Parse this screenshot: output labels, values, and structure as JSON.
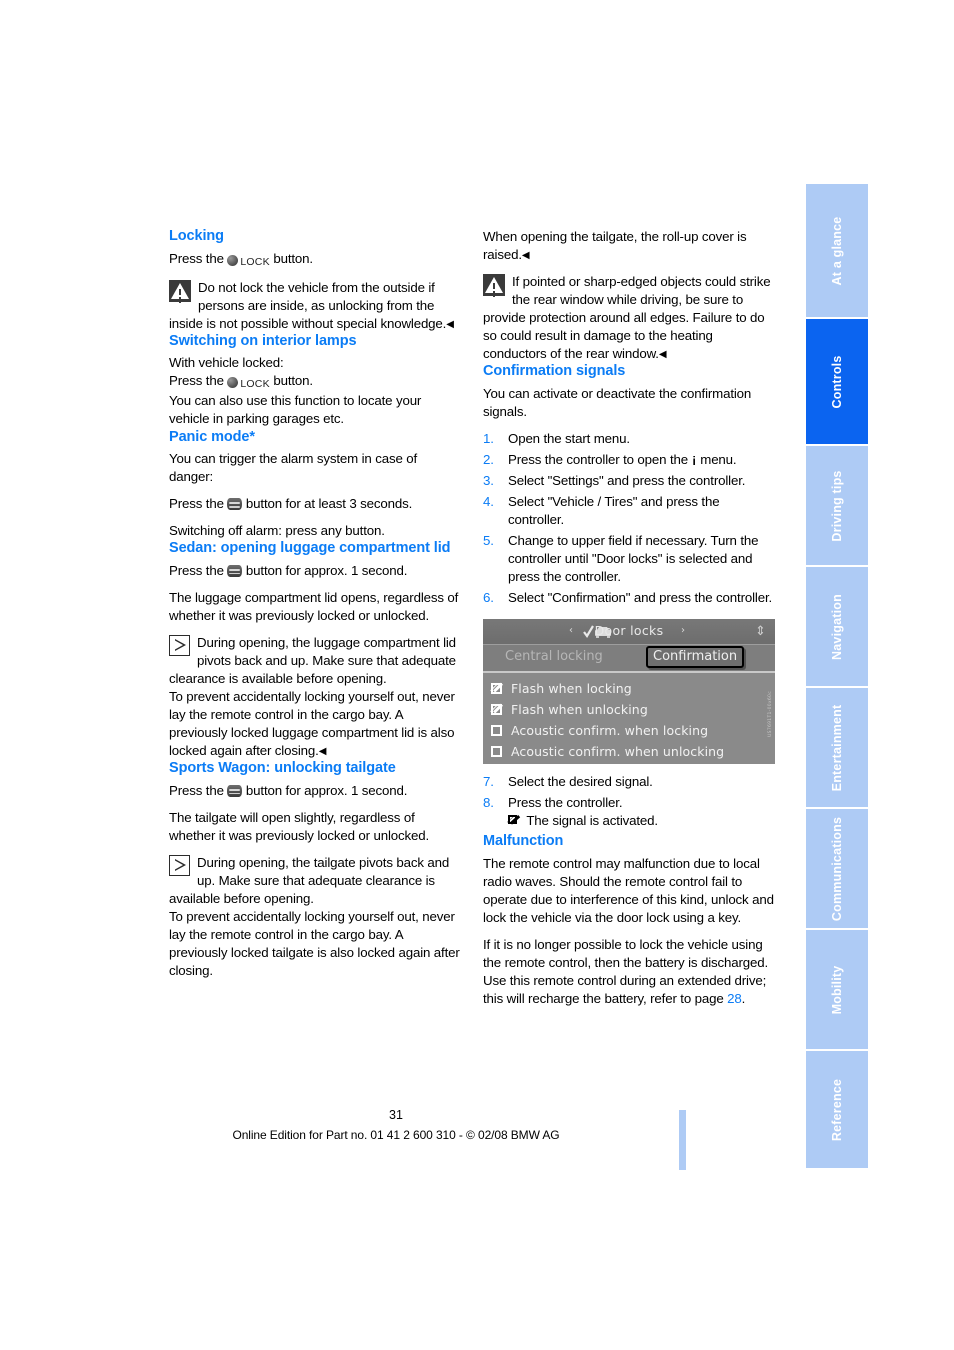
{
  "document": {
    "page_number": "31",
    "footer": "Online Edition for Part no. 01 41 2 600 310 - © 02/08 BMW AG",
    "accent_blue": "#0b7cf5",
    "tab_active_blue": "#0b64f0",
    "tab_inactive_blue": "#aecbf5"
  },
  "tabs": [
    {
      "label": "At a glance",
      "active": false
    },
    {
      "label": "Controls",
      "active": true
    },
    {
      "label": "Driving tips",
      "active": false
    },
    {
      "label": "Navigation",
      "active": false
    },
    {
      "label": "Entertainment",
      "active": false
    },
    {
      "label": "Communications",
      "active": false
    },
    {
      "label": "Mobility",
      "active": false
    },
    {
      "label": "Reference",
      "active": false
    }
  ],
  "left_column": {
    "locking": {
      "heading": "Locking",
      "press_prefix": "Press the ",
      "lock_label": "LOCK",
      "press_suffix": " button.",
      "warning": "Do not lock the vehicle from the outside if persons are inside, as unlocking from the inside is not possible without special knowledge."
    },
    "interior_lamps": {
      "heading": "Switching on interior lamps",
      "line1": "With vehicle locked:",
      "press_prefix": "Press the ",
      "lock_label": "LOCK",
      "press_suffix": " button.",
      "line2": "You can also use this function to locate your vehicle in parking garages etc."
    },
    "panic_mode": {
      "heading": "Panic mode*",
      "line1": "You can trigger the alarm system in case of danger:",
      "press_prefix": "Press the ",
      "press_suffix": " button for at least 3 seconds.",
      "line2": "Switching off alarm: press any button."
    },
    "sedan_luggage": {
      "heading": "Sedan: opening luggage compartment lid",
      "press_prefix": "Press the ",
      "press_suffix": " button for approx. 1 second.",
      "line1": "The luggage compartment lid opens, regardless of whether it was previously locked or unlocked.",
      "note": "During opening, the luggage compartment lid pivots back and up. Make sure that adequate clearance is available before opening.",
      "note2": "To prevent accidentally locking yourself out, never lay the remote control in the cargo bay. A previously locked luggage compartment lid is also locked again after closing."
    },
    "sports_wagon": {
      "heading": "Sports Wagon: unlocking tailgate",
      "press_prefix": "Press the ",
      "press_suffix": " button for approx. 1 second.",
      "line1": "The tailgate will open slightly, regardless of whether it was previously locked or unlocked.",
      "note": "During opening, the tailgate pivots back and up. Make sure that adequate clearance is available before opening.",
      "note2": "To prevent accidentally locking yourself out, never lay the remote control in the cargo bay. A previously locked tailgate is also locked again after closing."
    }
  },
  "right_column": {
    "rollup_cover": {
      "line1": "When opening the tailgate, the roll-up cover is raised.",
      "warning": "If pointed or sharp-edged objects could strike the rear window while driving, be sure to provide protection around all edges. Failure to do so could result in damage to the heating conductors of the rear window."
    },
    "confirmation_signals": {
      "heading": "Confirmation signals",
      "intro": "You can activate or deactivate the confirmation signals.",
      "steps": [
        {
          "num": "1.",
          "text": "Open the start menu."
        },
        {
          "num": "2.",
          "text_before": "Press the controller to open the ",
          "text_after": " menu."
        },
        {
          "num": "3.",
          "text": "Select \"Settings\" and press the controller."
        },
        {
          "num": "4.",
          "text": "Select \"Vehicle / Tires\" and press the controller."
        },
        {
          "num": "5.",
          "text": "Change to upper field if necessary. Turn the controller until \"Door locks\" is selected and press the controller."
        },
        {
          "num": "6.",
          "text": "Select \"Confirmation\" and press the controller."
        }
      ],
      "steps_after": [
        {
          "num": "7.",
          "text": "Select the desired signal."
        },
        {
          "num": "8.",
          "text": "Press the controller.",
          "sub": "The signal is activated."
        }
      ]
    },
    "malfunction": {
      "heading": "Malfunction",
      "p1": "The remote control may malfunction due to local radio waves. Should the remote control fail to operate due to interference of this kind, unlock and lock the vehicle via the door lock using a key.",
      "p2_before": "If it is no longer possible to lock the vehicle using the remote control, then the battery is discharged. Use this remote control during an extended drive; this will recharge the battery, refer to page ",
      "p2_link": "28",
      "p2_after": "."
    }
  },
  "idrive_screen": {
    "title": "Door locks",
    "arrow_left": "‹",
    "arrow_right": "›",
    "scroll_glyph": "⇕",
    "tab_inactive": "Central locking",
    "tab_active": "Confirmation",
    "watermark": "US7691T1-00x60c",
    "options": [
      {
        "label": "Flash when locking",
        "checked": true
      },
      {
        "label": "Flash when unlocking",
        "checked": true
      },
      {
        "label": "Acoustic confirm. when locking",
        "checked": false
      },
      {
        "label": "Acoustic confirm. when unlocking",
        "checked": false
      }
    ]
  }
}
